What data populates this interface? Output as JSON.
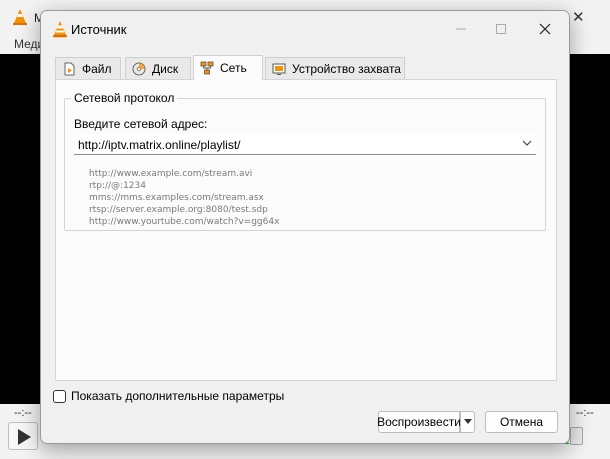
{
  "background_window": {
    "title": "М",
    "menu": "Меди",
    "time_left": "--:--",
    "time_right": "--:--"
  },
  "dialog": {
    "title": "Источник",
    "tabs": [
      {
        "label": "Файл",
        "icon": "file-icon"
      },
      {
        "label": "Диск",
        "icon": "disc-icon"
      },
      {
        "label": "Сеть",
        "icon": "network-icon",
        "active": true
      },
      {
        "label": "Устройство захвата",
        "icon": "capture-device-icon"
      }
    ],
    "network": {
      "group_title": "Сетевой протокол",
      "address_label": "Введите сетевой адрес:",
      "address_value": "http://iptv.matrix.online/playlist/",
      "examples": [
        "http://www.example.com/stream.avi",
        "rtp://@:1234",
        "mms://mms.examples.com/stream.asx",
        "rtsp://server.example.org:8080/test.sdp",
        "http://www.yourtube.com/watch?v=gg64x"
      ]
    },
    "show_more_options_label": "Показать дополнительные параметры",
    "show_more_options_checked": false,
    "play_button_label": "Воспроизвести",
    "cancel_button_label": "Отмена"
  }
}
